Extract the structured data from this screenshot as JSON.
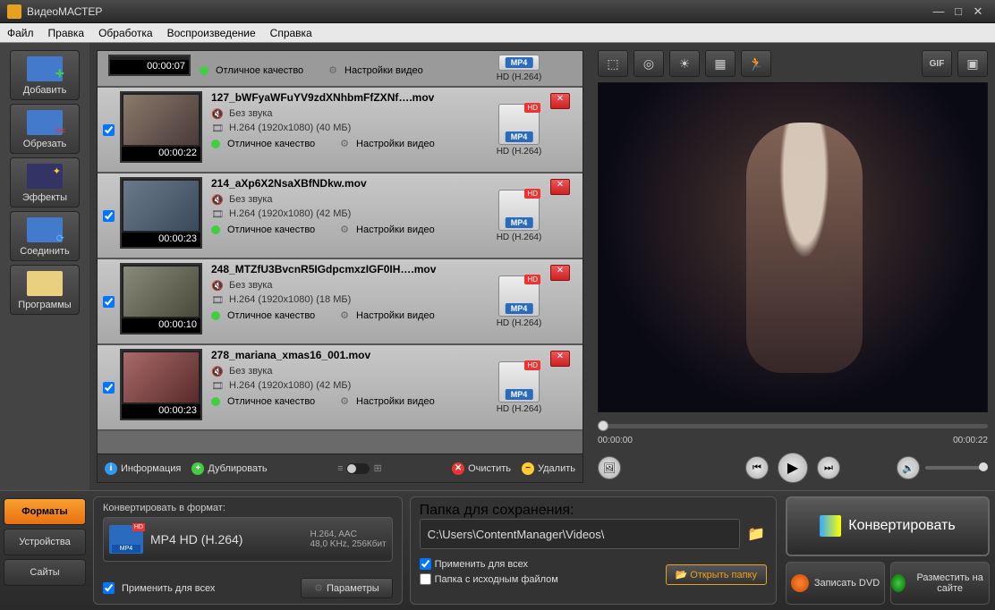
{
  "app": {
    "title": "ВидеоМАСТЕР"
  },
  "menu": [
    "Файл",
    "Правка",
    "Обработка",
    "Воспроизведение",
    "Справка"
  ],
  "sidebar": [
    {
      "label": "Добавить",
      "cls": "add"
    },
    {
      "label": "Обрезать",
      "cls": "cut"
    },
    {
      "label": "Эффекты",
      "cls": "fx"
    },
    {
      "label": "Соединить",
      "cls": "join"
    },
    {
      "label": "Программы",
      "cls": "prog"
    }
  ],
  "files": [
    {
      "partial": true,
      "dur": "00:00:07",
      "quality": "Отличное качество",
      "settings": "Настройки видео",
      "fmt": "MP4",
      "codec": "HD (H.264)"
    },
    {
      "name": "127_bWFyaWFuYV9zdXNhbmFfZXNf….mov",
      "audio": "Без звука",
      "spec": "H.264 (1920x1080) (40 МБ)",
      "dur": "00:00:22",
      "quality": "Отличное качество",
      "settings": "Настройки видео",
      "fmt": "MP4",
      "codec": "HD (H.264)"
    },
    {
      "name": "214_aXp6X2NsaXBfNDkw.mov",
      "audio": "Без звука",
      "spec": "H.264 (1920x1080) (42 МБ)",
      "dur": "00:00:23",
      "quality": "Отличное качество",
      "settings": "Настройки видео",
      "fmt": "MP4",
      "codec": "HD (H.264)"
    },
    {
      "name": "248_MTZfU3BvcnR5IGdpcmxzIGF0IH….mov",
      "audio": "Без звука",
      "spec": "H.264 (1920x1080) (18 МБ)",
      "dur": "00:00:10",
      "quality": "Отличное качество",
      "settings": "Настройки видео",
      "fmt": "MP4",
      "codec": "HD (H.264)"
    },
    {
      "name": "278_mariana_xmas16_001.mov",
      "audio": "Без звука",
      "spec": "H.264 (1920x1080) (42 МБ)",
      "dur": "00:00:23",
      "quality": "Отличное качество",
      "settings": "Настройки видео",
      "fmt": "MP4",
      "codec": "HD (H.264)"
    }
  ],
  "list_tools": {
    "info": "Информация",
    "dup": "Дублировать",
    "clear": "Очистить",
    "del": "Удалить"
  },
  "preview": {
    "t0": "00:00:00",
    "t1": "00:00:22"
  },
  "fmt_tabs": [
    "Форматы",
    "Устройства",
    "Сайты"
  ],
  "convert": {
    "label": "Конвертировать в формат:",
    "name": "MP4 HD (H.264)",
    "det1": "H.264, AAC",
    "det2": "48,0 KHz, 256Кбит",
    "apply_all": "Применить для всех",
    "params": "Параметры"
  },
  "save": {
    "label": "Папка для сохранения:",
    "path": "C:\\Users\\ContentManager\\Videos\\",
    "apply_all": "Применить для всех",
    "src_folder": "Папка с исходным файлом",
    "open": "Открыть папку"
  },
  "actions": {
    "convert": "Конвертировать",
    "dvd": "Записать DVD",
    "web": "Разместить на сайте"
  }
}
